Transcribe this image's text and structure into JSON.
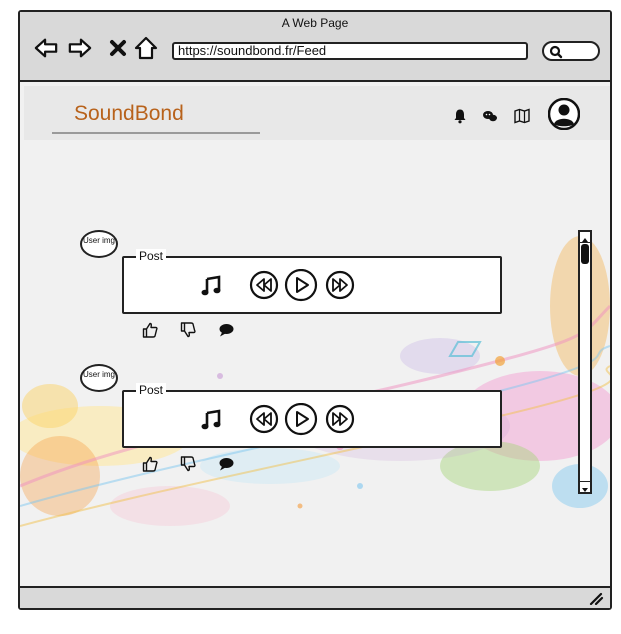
{
  "window": {
    "title": "A Web Page"
  },
  "nav": {
    "back_icon": "arrow-left-icon",
    "forward_icon": "arrow-right-icon",
    "close_icon": "x-icon",
    "home_icon": "home-icon"
  },
  "url_bar": {
    "value": "https://soundbond.fr/Feed"
  },
  "search": {
    "icon": "search-icon"
  },
  "app": {
    "brand": "SoundBond",
    "brand_color": "#b8621b",
    "header_icons": [
      "bell-icon",
      "chat-icon",
      "map-icon",
      "user-avatar-icon"
    ]
  },
  "posts": [
    {
      "user_img": "User img",
      "label": "Post",
      "controls": [
        "music-note-icon",
        "rewind-icon",
        "play-icon",
        "fast-forward-icon"
      ],
      "reactions": [
        "thumbs-up-icon",
        "thumbs-down-icon",
        "comment-icon"
      ]
    },
    {
      "user_img": "User img",
      "label": "Post",
      "controls": [
        "music-note-icon",
        "rewind-icon",
        "play-icon",
        "fast-forward-icon"
      ],
      "reactions": [
        "thumbs-up-icon",
        "thumbs-down-icon",
        "comment-icon"
      ]
    }
  ]
}
